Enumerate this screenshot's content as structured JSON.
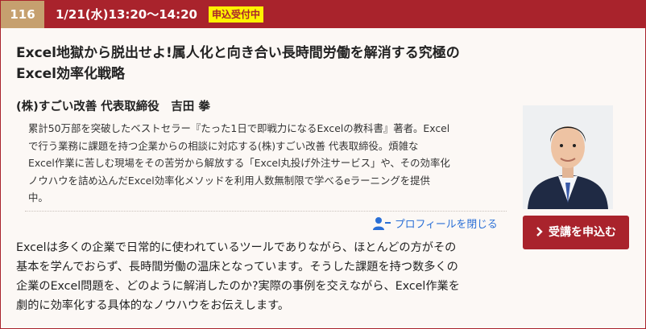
{
  "seminar": {
    "number": "116",
    "datetime": "1/21(水)13:20〜14:20",
    "status_badge": "申込受付中",
    "title_line1": "Excel地獄から脱出せよ!属人化と向き合い長時間労働を解消する究極の",
    "title_line2": "Excel効率化戦略",
    "speaker": "(株)すごい改善 代表取締役　吉田 拳",
    "profile": [
      "累計50万部を突破したベストセラー『たった1日で即戦力になるExcelの教科書』著者。Excel",
      "で行う業務に課題を持つ企業からの相談に対応する(株)すごい改善 代表取締役。煩雑な",
      "Excel作業に苦しむ現場をその苦労から解放する「Excel丸投げ外注サービス」や、その効率化",
      "ノウハウを詰め込んだExcel効率化メソッドを利用人数無制限で学べるeラーニングを提供",
      "中。"
    ],
    "profile_toggle": "プロフィールを閉じる",
    "description": [
      "Excelは多くの企業で日常的に使われているツールでありながら、ほとんどの方がその",
      "基本を学んでおらず、長時間労働の温床となっています。そうした課題を持つ数多くの",
      "企業のExcel問題を、どのように解消したのか?実際の事例を交えながら、Excel作業を",
      "劇的に効率化する具体的なノウハウをお伝えします。"
    ],
    "apply_label": "受講を申込む",
    "apply_icon": "chevron-right-icon"
  },
  "colors": {
    "brand": "#a9232c",
    "number_bg": "#c6a06f",
    "badge_bg": "#fff200",
    "link": "#2a6fd6",
    "card_bg": "#fcf8f5"
  }
}
